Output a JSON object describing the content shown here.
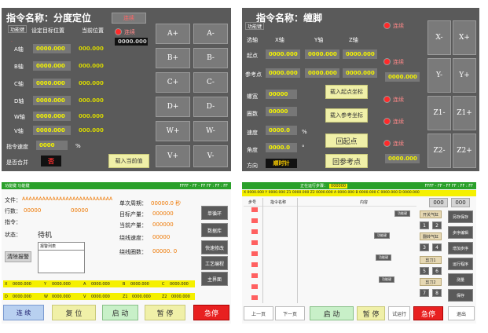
{
  "p1": {
    "title": "指令名称：分度定位",
    "func_key": "功能键",
    "col_target": "设定目标位置",
    "col_current": "当前位置",
    "rows": [
      {
        "axis": "A轴",
        "target": "0000.000",
        "current": "000.000"
      },
      {
        "axis": "B轴",
        "target": "0000.000",
        "current": "000.000"
      },
      {
        "axis": "C轴",
        "target": "0000.000",
        "current": "000.000"
      },
      {
        "axis": "D轴",
        "target": "0000.000",
        "current": "000.000"
      },
      {
        "axis": "W轴",
        "target": "0000.000",
        "current": "000.000"
      },
      {
        "axis": "V轴",
        "target": "0000.000",
        "current": "000.000"
      }
    ],
    "speed_label": "指令速度",
    "speed_value": "0000",
    "speed_unit": "%",
    "merge_label": "是否合并",
    "merge_value": "否",
    "top_tag": "连续",
    "link_label": "连续",
    "link_value": "0000.000",
    "load_btn": "载入当前值",
    "jog": [
      [
        "A+",
        "A-"
      ],
      [
        "B+",
        "B-"
      ],
      [
        "C+",
        "C-"
      ],
      [
        "D+",
        "D-"
      ],
      [
        "W+",
        "W-"
      ],
      [
        "V+",
        "V-"
      ]
    ]
  },
  "p2": {
    "title": "指令名称：缠脚",
    "func_key": "功能键",
    "cols": [
      "选轴",
      "X轴",
      "Y轴",
      "Z轴"
    ],
    "start_label": "起点",
    "ref_label": "参考点",
    "start_vals": [
      "0000.000",
      "0000.000",
      "0000.000"
    ],
    "ref_vals": [
      "0000.000",
      "0000.000",
      "0000.000"
    ],
    "pitch_label": "螺宽",
    "pitch_val": "00000",
    "turns_label": "圈数",
    "turns_val": "00000",
    "speed_label": "速度",
    "speed_val": "0000.0",
    "speed_unit": "%",
    "angle_label": "角度",
    "angle_val": "0000.0",
    "angle_unit": "°",
    "dir_label": "方向",
    "dir_val": "顺时针",
    "btn_load_start": "载入起点坐标",
    "btn_load_ref": "载入参考坐标",
    "btn_back_start": "回起点",
    "btn_back_ref": "回参考点",
    "link": "连续",
    "jog": [
      [
        "X-",
        "X+"
      ],
      [
        "Y-",
        "Y+"
      ],
      [
        "Z1-",
        "Z1+"
      ],
      [
        "Z2-",
        "Z2+"
      ]
    ]
  },
  "p3": {
    "header": "功能键   功能键",
    "header_right": "FFFF - FF - FF      FF : FF : FF",
    "file_label": "文件：",
    "file_value": "AAAAAAAAAAAAAAAAAAAAAAAAAAA",
    "row_label": "行数：",
    "row_value": "00000",
    "row_value2": "00000",
    "cmd_label": "指令：",
    "state_label": "状态：",
    "state_value": "待机",
    "cycle_label": "单次周期：",
    "cycle_value": "00000.0 秒",
    "target_label": "目标产量：",
    "target_value": "000000",
    "current_label": "当前产量：",
    "current_value": "000000",
    "wind_speed_label": "绕线速度：",
    "wind_speed_value": "00000",
    "wind_turns_label": "绕线圈数：",
    "wind_turns_value": "00000. 0",
    "clear_btn": "清除报警",
    "alarm_list": "报警列表",
    "side_btns": [
      "单循环",
      "数据库",
      "快速修改",
      "工艺编程",
      "主界面"
    ],
    "coords1": [
      [
        "X",
        "0000.000"
      ],
      [
        "Y",
        "0000.000"
      ],
      [
        "A",
        "0000.000"
      ],
      [
        "B",
        "0000.000"
      ],
      [
        "C",
        "0000.000"
      ]
    ],
    "coords2": [
      [
        "D",
        "0000.000"
      ],
      [
        "W",
        "0000.000"
      ],
      [
        "V",
        "0000.000"
      ],
      [
        "Z1",
        "0000.000"
      ],
      [
        "Z2",
        "0000.000"
      ]
    ],
    "btn_link": "连 续",
    "btn_reset": "复 位",
    "btn_start": "启 动",
    "btn_pause": "暂 停",
    "btn_estop": "急停"
  },
  "p4": {
    "header": "正在运行步骤：",
    "header_num": "000000",
    "header_right": "FFFF - FF - FF      FF : FF : FF",
    "coord_strip": "X 0000.000  Y 0000.000  Z1 0000.000  Z2 0000.000  A 0000.000  B 0000.000  C 0000.000  D 0000.000",
    "col_step": "步号",
    "col_name": "指令名称",
    "col_content": "内容",
    "top_vals": [
      "000",
      "000"
    ],
    "side_btns": [
      "另存保存",
      "步序编辑",
      "增加步序",
      "运行程序",
      "测量",
      "保存"
    ],
    "mini_labels": [
      "开关气缸",
      "翻转气缸",
      "剪刀1",
      "剪刀2"
    ],
    "mini_keys": [
      [
        "1",
        "2"
      ],
      [
        "3",
        "4"
      ],
      [
        "5",
        "6"
      ],
      [
        "7",
        "8"
      ]
    ],
    "func_keys": [
      "功能键",
      "功能键",
      "功能键",
      "功能键"
    ],
    "bottom": [
      "上一页",
      "下一页",
      "启 动",
      "暂 停",
      "试运行",
      "急停",
      "退出"
    ]
  }
}
